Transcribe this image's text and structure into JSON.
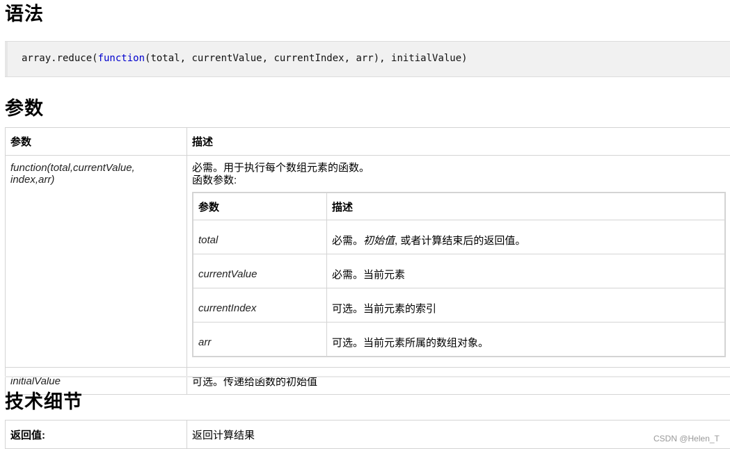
{
  "syntax": {
    "heading": "语法",
    "code": {
      "prefix": "array.reduce(",
      "keyword": "function",
      "suffix": "(total, currentValue, currentIndex, arr), initialValue)"
    }
  },
  "params": {
    "heading": "参数",
    "header": {
      "col1": "参数",
      "col2": "描述"
    },
    "function_row": {
      "name": "function(total,currentValue, index,arr)",
      "desc_line1": "必需。用于执行每个数组元素的函数。",
      "desc_line2": "函数参数:",
      "inner_header": {
        "col1": "参数",
        "col2": "描述"
      },
      "inner_rows": [
        {
          "name": "total",
          "desc_pre": "必需。",
          "desc_em": "初始值",
          "desc_post": ", 或者计算结束后的返回值。"
        },
        {
          "name": "currentValue",
          "desc": "必需。当前元素"
        },
        {
          "name": "currentIndex",
          "desc": "可选。当前元素的索引"
        },
        {
          "name": "arr",
          "desc": "可选。当前元素所属的数组对象。"
        }
      ]
    },
    "initial_row": {
      "name": "initialValue",
      "desc": "可选。传递给函数的初始值"
    }
  },
  "tech": {
    "heading": "技术细节",
    "rows": [
      {
        "label": "返回值:",
        "value": "返回计算结果"
      }
    ]
  },
  "watermark": "CSDN @Helen_T"
}
